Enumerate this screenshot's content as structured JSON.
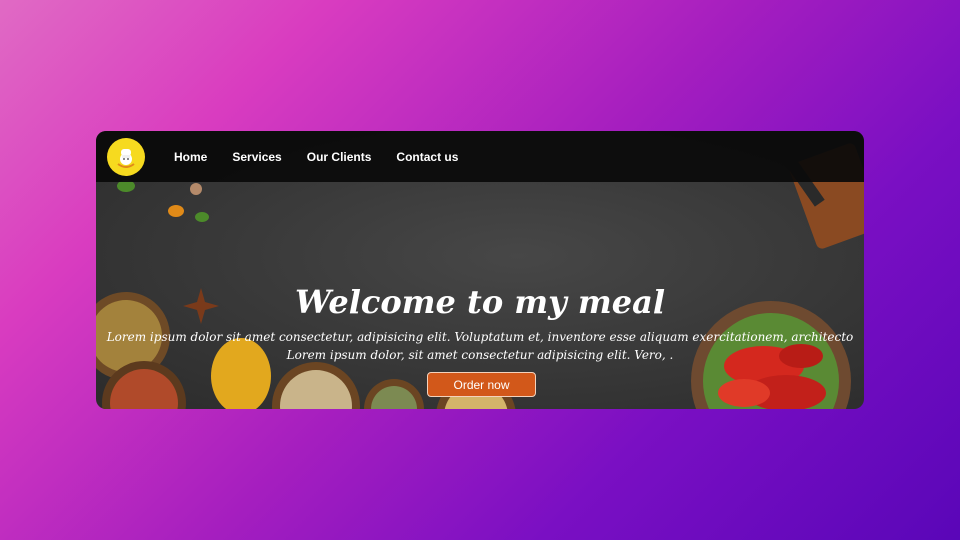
{
  "navbar": {
    "logo_icon": "chef-hat-logo-icon",
    "links": [
      {
        "label": "Home"
      },
      {
        "label": "Services"
      },
      {
        "label": "Our Clients"
      },
      {
        "label": "Contact us"
      }
    ]
  },
  "hero": {
    "title": "Welcome to my meal",
    "line1": "Lorem ipsum dolor sit amet consectetur, adipisicing elit. Voluptatum et, inventore esse aliquam exercitationem, architecto",
    "line2": "Lorem ipsum dolor, sit amet consectetur adipisicing elit. Vero, .",
    "button_label": "Order now"
  },
  "colors": {
    "background_gradient_start": "#e06ac4",
    "background_gradient_end": "#5a06b8",
    "navbar": "#0a0a0a",
    "logo": "#f6da1f",
    "button": "#d2581a"
  }
}
